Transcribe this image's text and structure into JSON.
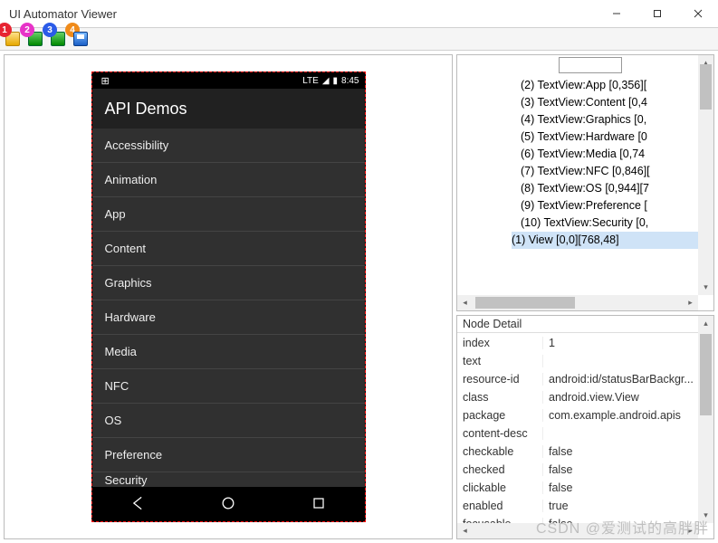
{
  "window": {
    "title": "UI Automator Viewer"
  },
  "toolbar_badges": [
    "1",
    "2",
    "3",
    "4"
  ],
  "phone": {
    "status": {
      "lte": "LTE",
      "time": "8:45"
    },
    "header": "API Demos",
    "items": [
      "Accessibility",
      "Animation",
      "App",
      "Content",
      "Graphics",
      "Hardware",
      "Media",
      "NFC",
      "OS",
      "Preference",
      "Security"
    ]
  },
  "tree": {
    "items": [
      "(2) TextView:App [0,356][",
      "(3) TextView:Content [0,4",
      "(4) TextView:Graphics [0,",
      "(5) TextView:Hardware [0",
      "(6) TextView:Media [0,74",
      "(7) TextView:NFC [0,846][",
      "(8) TextView:OS [0,944][7",
      "(9) TextView:Preference [",
      "(10) TextView:Security [0,"
    ],
    "selected": "(1) View [0,0][768,48]"
  },
  "detail": {
    "title": "Node Detail",
    "rows": [
      {
        "k": "index",
        "v": "1"
      },
      {
        "k": "text",
        "v": ""
      },
      {
        "k": "resource-id",
        "v": "android:id/statusBarBackgr..."
      },
      {
        "k": "class",
        "v": "android.view.View"
      },
      {
        "k": "package",
        "v": "com.example.android.apis"
      },
      {
        "k": "content-desc",
        "v": ""
      },
      {
        "k": "checkable",
        "v": "false"
      },
      {
        "k": "checked",
        "v": "false"
      },
      {
        "k": "clickable",
        "v": "false"
      },
      {
        "k": "enabled",
        "v": "true"
      },
      {
        "k": "focusable",
        "v": "false"
      }
    ]
  },
  "watermark": "CSDN @爱测试的高胖胖"
}
